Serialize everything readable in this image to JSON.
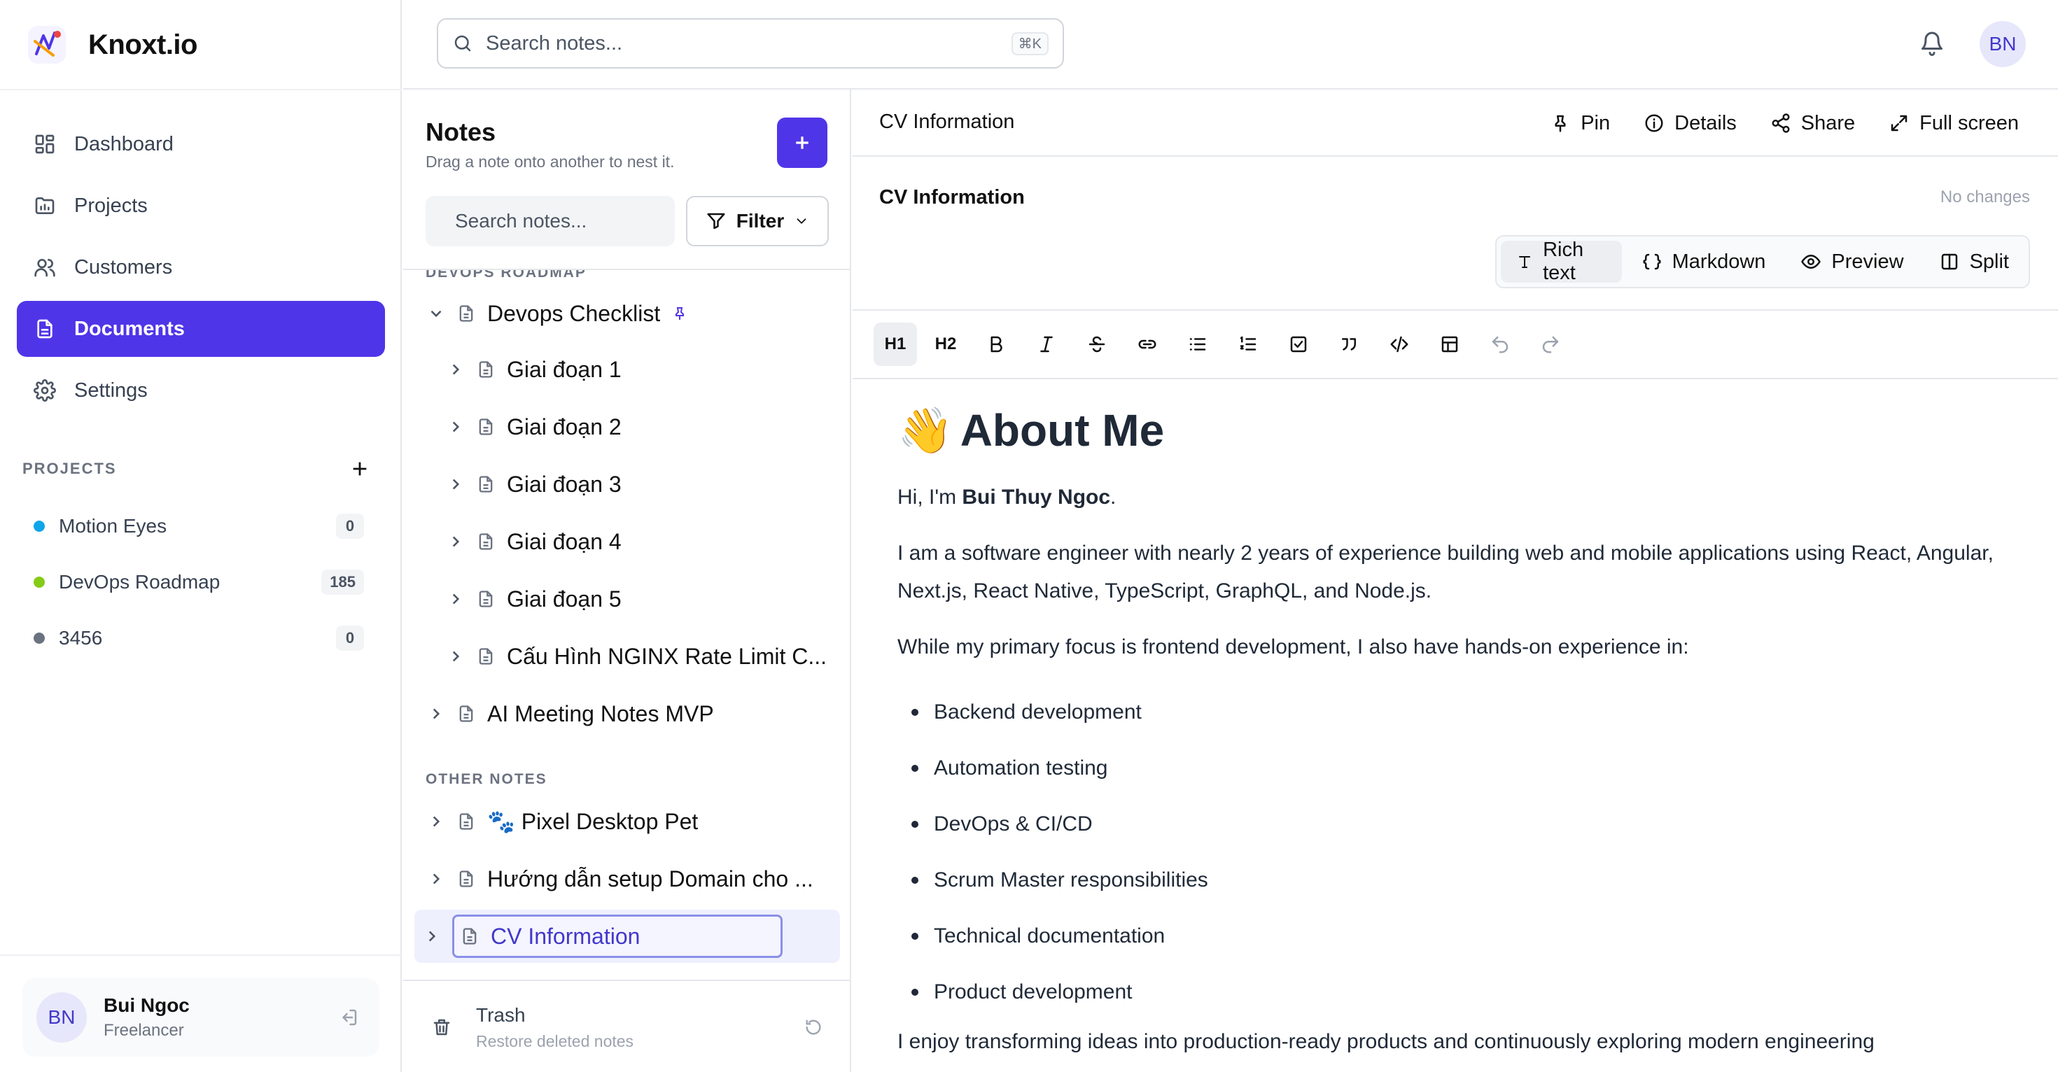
{
  "brand": {
    "name": "Knoxt.io"
  },
  "nav": [
    {
      "label": "Dashboard",
      "icon": "grid-icon",
      "active": false
    },
    {
      "label": "Projects",
      "icon": "folder-chart-icon",
      "active": false
    },
    {
      "label": "Customers",
      "icon": "users-icon",
      "active": false
    },
    {
      "label": "Documents",
      "icon": "document-icon",
      "active": true
    },
    {
      "label": "Settings",
      "icon": "gear-icon",
      "active": false
    }
  ],
  "projects": {
    "title": "PROJECTS",
    "items": [
      {
        "name": "Motion Eyes",
        "count": "0",
        "color": "#0ea5e9"
      },
      {
        "name": "DevOps Roadmap",
        "count": "185",
        "color": "#84cc16"
      },
      {
        "name": "3456",
        "count": "0",
        "color": "#6b7280"
      }
    ]
  },
  "user": {
    "initials": "BN",
    "name": "Bui Ngoc",
    "role": "Freelancer"
  },
  "topbar": {
    "search_placeholder": "Search notes...",
    "shortcut": "⌘K",
    "avatar": "BN"
  },
  "notes": {
    "title": "Notes",
    "subtitle": "Drag a note onto another to nest it.",
    "search_placeholder": "Search notes...",
    "filter_label": "Filter",
    "section_project": "DEVOPS ROADMAP",
    "section_other": "OTHER NOTES",
    "tree": [
      {
        "label": "Devops Checklist",
        "expanded": true,
        "pinned": true
      },
      {
        "label": "Giai đoạn 1"
      },
      {
        "label": "Giai đoạn 2"
      },
      {
        "label": "Giai đoạn 3"
      },
      {
        "label": "Giai đoạn 4"
      },
      {
        "label": "Giai đoạn 5"
      },
      {
        "label": "Cấu Hình NGINX Rate Limit C..."
      },
      {
        "label": "AI Meeting Notes MVP"
      }
    ],
    "other": [
      {
        "label": "🐾 Pixel Desktop Pet"
      },
      {
        "label": "Hướng dẫn setup Domain cho ..."
      },
      {
        "label": "CV Information",
        "selected": true
      }
    ],
    "trash_title": "Trash",
    "trash_sub": "Restore deleted notes"
  },
  "editor": {
    "header_title": "CV Information",
    "actions": {
      "pin": "Pin",
      "details": "Details",
      "share": "Share",
      "fullscreen": "Full screen"
    },
    "doc_title": "CV Information",
    "save_status": "No changes",
    "modes": {
      "rich": "Rich text",
      "markdown": "Markdown",
      "preview": "Preview",
      "split": "Split"
    },
    "toolbar": {
      "h1": "H1",
      "h2": "H2"
    },
    "content": {
      "heading": "About Me",
      "emoji": "👋",
      "hi_prefix": "Hi, I'm ",
      "hi_name": "Bui Thuy Ngoc",
      "hi_suffix": ".",
      "experience": "I am a software engineer with nearly 2 years of experience building web and mobile applications using React, Angular, Next.js, React Native, TypeScript, GraphQL, and Node.js.",
      "focus": "While my primary focus is frontend development, I also have hands-on experience in:",
      "skills": [
        "Backend development",
        "Automation testing",
        "DevOps & CI/CD",
        "Scrum Master responsibilities",
        "Technical documentation",
        "Product development"
      ],
      "enjoy": "I enjoy transforming ideas into production-ready products and continuously exploring modern engineering"
    }
  }
}
